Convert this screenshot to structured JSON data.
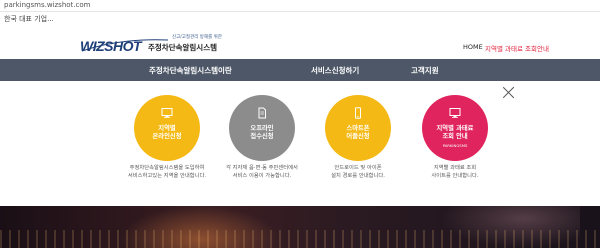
{
  "browser": {
    "url": "parkingsms.wizshot.com",
    "tab_text": "한국 대표 기업..."
  },
  "header": {
    "logo_tagline": "신고/고질관리 방해를 위한",
    "logo_brand": "WIZSHOT",
    "logo_name": "주정차단속알림시스템",
    "home_link": "HOME",
    "region_link": "지역별 과태료 조회안내"
  },
  "nav": {
    "items": [
      {
        "label": "주정차단속알림시스템이란"
      },
      {
        "label": "서비스신청하기"
      },
      {
        "label": "고객지원"
      }
    ]
  },
  "services": [
    {
      "line1": "지역별",
      "line2": "온라인신청",
      "sub": "",
      "color": "#f5b916",
      "icon": "monitor-icon",
      "desc1": "주정차단속알림시스템을 도입하여",
      "desc2": "서비스하고있는 지역을 안내합니다."
    },
    {
      "line1": "오프라인",
      "line2": "접수신청",
      "sub": "",
      "color": "#8c8c8c",
      "icon": "document-icon",
      "desc1": "각 지자체 읍·면·동 주민센터에서",
      "desc2": "서비스 이용이 가능합니다."
    },
    {
      "line1": "스마트폰",
      "line2": "어플신청",
      "sub": "",
      "color": "#f5b916",
      "icon": "smartphone-icon",
      "desc1": "안드로이드 및 아이폰",
      "desc2": "설치 경로를 안내합니다."
    },
    {
      "line1": "지역별 과태료",
      "line2": "조회 안내",
      "sub": "PARKINGSMS",
      "color": "#e0245e",
      "icon": "monitor-icon",
      "desc1": "지역별 과태료 조회",
      "desc2": "사이트를 안내합니다."
    }
  ]
}
